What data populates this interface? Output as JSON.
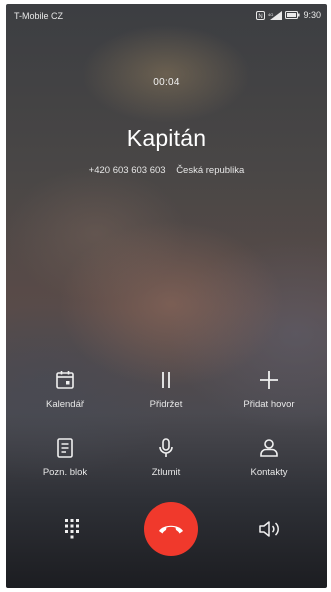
{
  "status_bar": {
    "carrier": "T-Mobile CZ",
    "time": "9:30",
    "icons": [
      "nfc-icon",
      "signal-icon",
      "battery-icon"
    ]
  },
  "call": {
    "timer": "00:04",
    "name": "Kapitán",
    "number": "+420 603 603 603",
    "location": "Česká republika"
  },
  "actions": [
    {
      "label": "Kalendář",
      "icon": "calendar-icon"
    },
    {
      "label": "Přidržet",
      "icon": "pause-icon"
    },
    {
      "label": "Přidat hovor",
      "icon": "plus-icon"
    },
    {
      "label": "Pozn. blok",
      "icon": "notepad-icon"
    },
    {
      "label": "Ztlumit",
      "icon": "microphone-icon"
    },
    {
      "label": "Kontakty",
      "icon": "contacts-icon"
    }
  ],
  "bottom": {
    "left_icon": "dialpad-icon",
    "center_icon": "end-call-icon",
    "right_icon": "speaker-icon",
    "end_call_color": "#f0392c"
  }
}
